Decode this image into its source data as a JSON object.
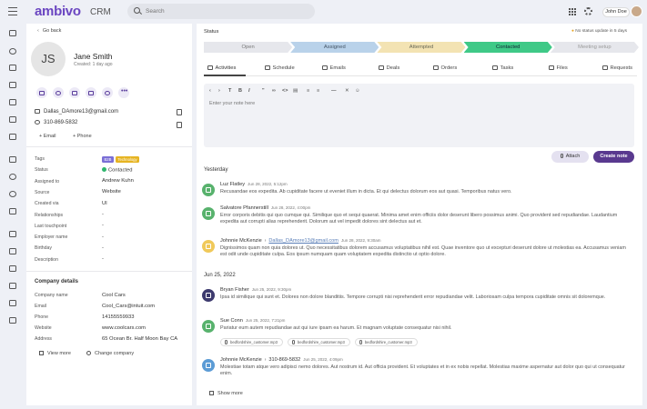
{
  "app": {
    "logo": "ambivo",
    "product": "CRM",
    "search_placeholder": "Search",
    "user_name": "John Doe"
  },
  "contact": {
    "back_label": "Go back",
    "initials": "JS",
    "name": "Jane Smith",
    "created": "Created: 1 day ago",
    "email": "Dallas_DAmore13@gmail.com",
    "phone": "310-869-5832",
    "add_email": "+  Email",
    "add_phone": "+  Phone"
  },
  "properties": [
    {
      "label": "Tags",
      "value": ""
    },
    {
      "label": "Status",
      "value": "Contacted"
    },
    {
      "label": "Assigned to",
      "value": "Andrew Kuhn"
    },
    {
      "label": "Source",
      "value": "Website"
    },
    {
      "label": "Created via",
      "value": "UI"
    },
    {
      "label": "Relationships",
      "value": "-"
    },
    {
      "label": "Last touchpoint",
      "value": "-"
    },
    {
      "label": "Employer name",
      "value": "-"
    },
    {
      "label": "Birthday",
      "value": "-"
    },
    {
      "label": "Description",
      "value": "-"
    }
  ],
  "tags": [
    {
      "label": "B2B",
      "color": "#7b6fd6"
    },
    {
      "label": "Technology",
      "color": "#e6b422"
    }
  ],
  "company": {
    "title": "Company details",
    "fields": [
      {
        "label": "Company name",
        "value": "Cool Cars"
      },
      {
        "label": "Email",
        "value": "Cool_Cars@intuit.com"
      },
      {
        "label": "Phone",
        "value": "14155559933"
      },
      {
        "label": "Website",
        "value": "www.coolcars.com"
      },
      {
        "label": "Address",
        "value": "65 Ocean Br. Half Moon Bay CA"
      }
    ],
    "view_more": "View more",
    "change_company": "Change company"
  },
  "status": {
    "title": "Status",
    "notice": "No status update in 5 days",
    "stages": [
      {
        "label": "Open",
        "bg": "#e6e7ec",
        "fg": "#777"
      },
      {
        "label": "Assigned",
        "bg": "#b9d2ea",
        "fg": "#456"
      },
      {
        "label": "Attempted",
        "bg": "#f3e3b3",
        "fg": "#665"
      },
      {
        "label": "Contacted",
        "bg": "#3fc987",
        "fg": "#123"
      },
      {
        "label": "Meeting setup",
        "bg": "#e6e7ec",
        "fg": "#999"
      }
    ]
  },
  "tabs": [
    "Activities",
    "Schedule",
    "Emails",
    "Deals",
    "Orders",
    "Tasks",
    "Files",
    "Requests"
  ],
  "editor": {
    "placeholder": "Enter your note here",
    "attach_label": "Attach",
    "create_label": "Create note"
  },
  "groups": [
    {
      "label": "Yesterday"
    },
    {
      "label": "Jun 25, 2022"
    }
  ],
  "activities": [
    {
      "author": "Luz Flatley",
      "target": "",
      "date": "Jun 28, 2022, 5:12pm",
      "body": "Recusandae eos expedita. Ab cupiditate facere ut eveniet illum in dicta. Et qui delectus dolorum eos aut quasi. Temporibus natus vero.",
      "color": "#58b26d"
    },
    {
      "author": "Salvatore Pfannerstill",
      "target": "",
      "date": "Jun 28, 2022, 4:00pm",
      "body": "Error corporis debitis qui quo cumque qui. Similique quo et sequi quaerat. Minima amet enim officiis dolor deserunt libero possimus animi. Quo provident sed repudiandae. Laudantium expedita aut corrupti alias reprehenderit. Dolorum aut vel impedit dolores sint delectus aut et.",
      "color": "#58b26d"
    },
    {
      "author": "Johnnie McKenzie",
      "target": "Dallas_DAmore13@gmail.com",
      "date": "Jun 28, 2022, 9:30am",
      "body": "Dignissimos quam non quia dolores ut. Quo necessitatibus dolorem accusamus voluptatibus nihil est. Quae inventore quo ut excepturi deserunt dolore ut molestias ea. Accusamus veniam est odit unde cupiditate culpa. Eos ipsum numquam quam voluptatem expedita distinctio ut optio dolore.",
      "color": "#f0c95a"
    },
    {
      "author": "Bryan Fisher",
      "target": "",
      "date": "Jun 25, 2022, 9:30pm",
      "body": "Ipsa id similique qui sunt et. Dolores non dolore blanditiis. Tempore corrupti nisi reprehenderit error repudiandae velit. Laboriosam culpa tempora cupiditate omnis sit doloremque.",
      "color": "#3d3a6e"
    },
    {
      "author": "Sue Conn",
      "target": "",
      "date": "Jun 25, 2022, 7:21pm",
      "body": "Pariatur eum autem repudiandae aut qui iure ipsam ea harum. Et magnam voluptate consequatur nisi nihil.",
      "color": "#58b26d"
    },
    {
      "author": "Johnnie McKenzie",
      "target": "310-869-5832",
      "date": "Jun 25, 2022, 4:09pm",
      "body": "Molestiae totam atque vero adipisci nemo dolores. Aut nostrum id. Aut officia provident. Et voluptates et in ex nobis repellat. Molestias maxime aspernatur aut dolor quo qui ut consequatur enim.",
      "color": "#5b9bd5"
    }
  ],
  "attachments": [
    "bedfordshire_customer.mp3",
    "bedfordshire_customer.mp3",
    "bedfordshire_customer.mp3"
  ],
  "show_more": "Show more"
}
